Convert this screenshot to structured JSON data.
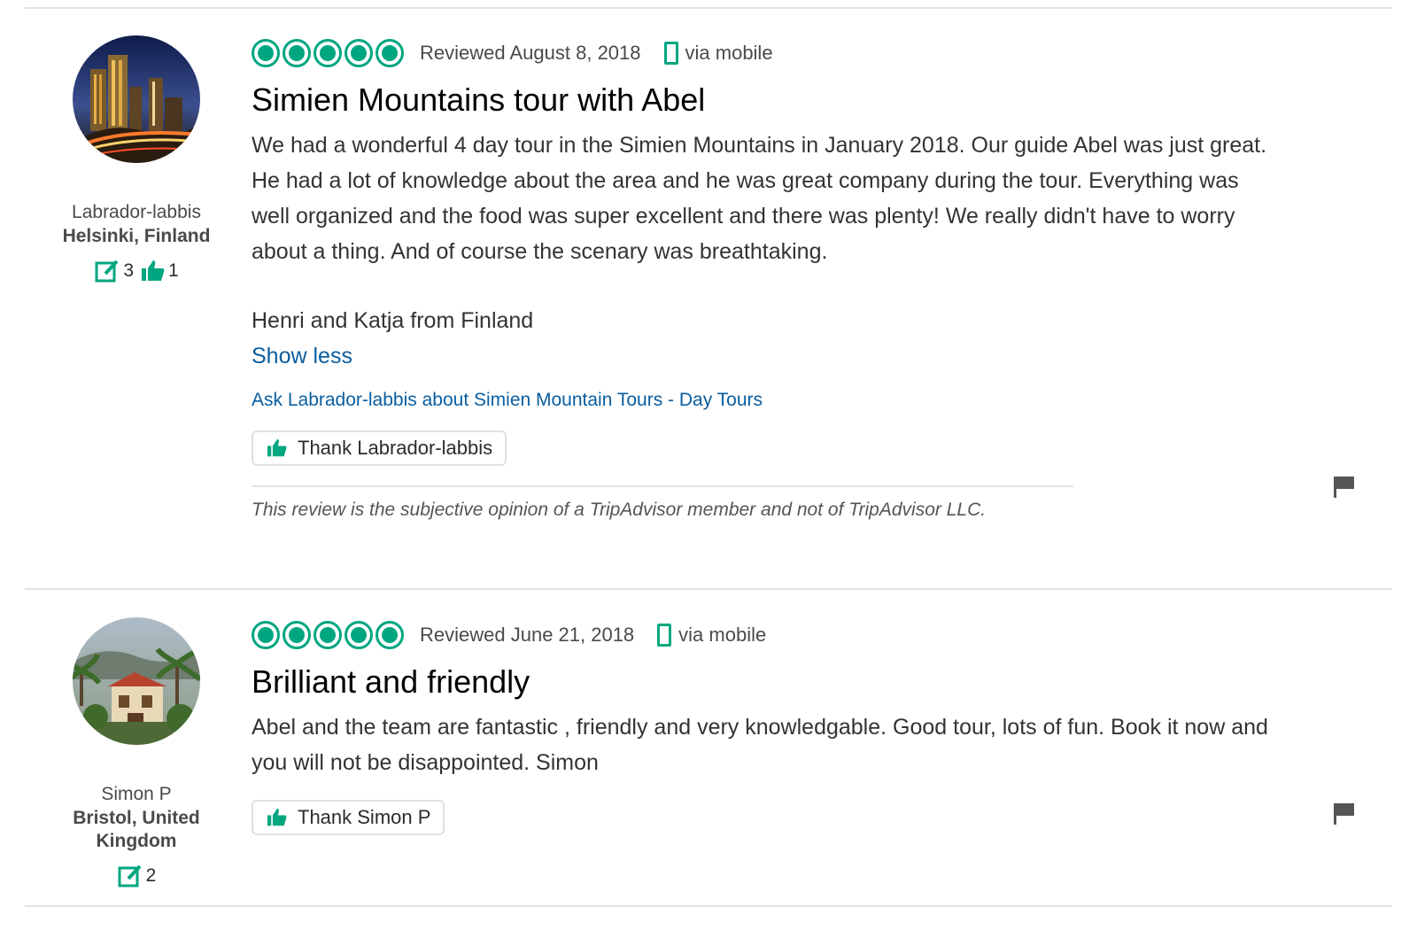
{
  "reviews": [
    {
      "username": "Labrador-labbis",
      "location": "Helsinki, Finland",
      "contributions": "3",
      "helpful_votes": "1",
      "rating": 5,
      "date": "Reviewed August 8, 2018",
      "via": "via mobile",
      "title": "Simien Mountains tour with Abel",
      "body": "We had a wonderful 4 day tour in the Simien Mountains in January 2018. Our guide Abel was just great. He had a lot of knowledge about the area and he was great company during the tour. Everything was well organized and the food was super excellent and there was plenty! We really didn't have to worry about a thing. And of course the scenary was breathtaking.",
      "signature": "Henri and Katja from Finland",
      "show_less": "Show less",
      "ask": "Ask Labrador-labbis about Simien Mountain Tours - Day Tours",
      "thank": "Thank Labrador-labbis",
      "disclaimer": "This review is the subjective opinion of a TripAdvisor member and not of TripAdvisor LLC."
    },
    {
      "username": "Simon P",
      "location": "Bristol, United Kingdom",
      "contributions": "2",
      "rating": 5,
      "date": "Reviewed June 21, 2018",
      "via": "via mobile",
      "title": "Brilliant and friendly",
      "body": "Abel and the team are fantastic , friendly and very knowledgable. Good tour, lots of fun. Book it now and you will not be disappointed. Simon",
      "thank": "Thank Simon P"
    }
  ],
  "colors": {
    "brand_green": "#00a680",
    "link_blue": "#0a5ea0"
  },
  "icons": [
    "review-count-icon",
    "thumbs-up-icon",
    "mobile-icon",
    "flag-icon",
    "rating-bubble-icon"
  ]
}
